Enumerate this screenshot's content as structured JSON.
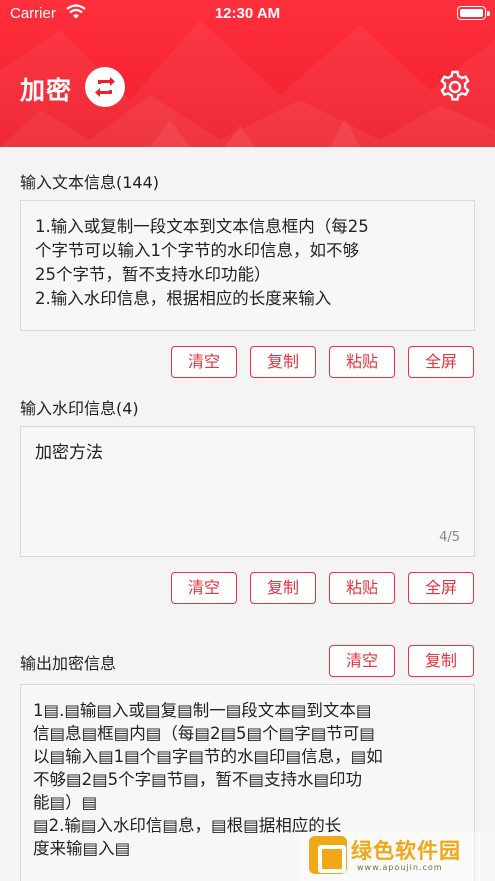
{
  "status_bar": {
    "carrier": "Carrier",
    "time": "12:30 AM"
  },
  "header": {
    "title": "加密",
    "swap_icon": "swap-arrows-icon",
    "settings_icon": "gear-icon",
    "accent_color": "#ef1e2c"
  },
  "input_text": {
    "label": "输入文本信息(144)",
    "lines": [
      "1.输入或复制一段文本到文本信息框内（每25",
      "个字节可以输入1个字节的水印信息，如不够",
      "25个字节，暂不支持水印功能）",
      "2.输入水印信息，根据相应的长度来输入"
    ],
    "buttons": {
      "clear": "清空",
      "copy": "复制",
      "paste": "粘贴",
      "fullscreen": "全屏"
    }
  },
  "watermark_input": {
    "label": "输入水印信息(4)",
    "value": "加密方法",
    "counter": "4/5",
    "buttons": {
      "clear": "清空",
      "copy": "复制",
      "paste": "粘贴",
      "fullscreen": "全屏"
    }
  },
  "output": {
    "label": "输出加密信息",
    "buttons": {
      "clear": "清空",
      "copy": "复制"
    },
    "lines": [
      "1▤.▤输▤入或▤复▤制一▤段文本▤到文本▤",
      "信▤息▤框▤内▤（每▤2▤5▤个▤字▤节可▤",
      "以▤输入▤1▤个▤字▤节的水▤印▤信息，▤如",
      "不够▤2▤5个字▤节▤，暂不▤支持水▤印功",
      "能▤）▤",
      "▤2.输▤入水印信▤息，▤根▤据相应的长",
      "度来输▤入▤"
    ]
  },
  "site_watermark": {
    "name": "绿色软件园",
    "url": "www.apoujin.com"
  }
}
